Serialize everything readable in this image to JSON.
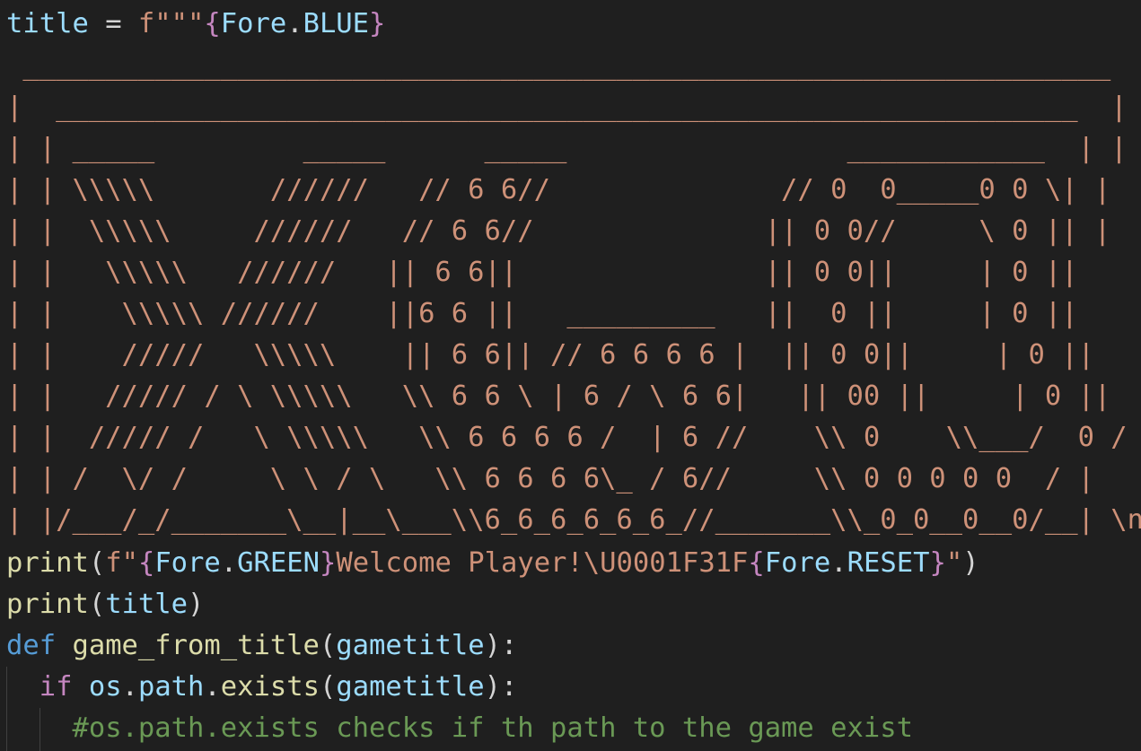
{
  "editor": {
    "colors": {
      "background": "#1f1f1f",
      "default_text": "#d4d4d4",
      "keyword": "#569cd6",
      "control": "#c586c0",
      "function": "#dcdcaa",
      "variable": "#9cdcfe",
      "string": "#ce9178",
      "comment": "#6a9955",
      "indent_guide": "#404040"
    },
    "line1": {
      "var": "title",
      "op": " = ",
      "prefix": "f\"\"\"",
      "brace_open": "{",
      "obj": "Fore",
      "dot": ".",
      "attr": "BLUE",
      "brace_close": "}"
    },
    "ascii_art": [
      " __________________________________________________________________",
      "|  ______________________________________________________________  |",
      "| | _____         _____      _____                 ____________  | |",
      "| | \\\\\\\\\\       //////   // 6 6//              // 0  0_____0 0 \\| |",
      "| |  \\\\\\\\\\     //////   // 6 6//              || 0 0//     \\ 0 || |",
      "| |   \\\\\\\\\\   //////   || 6 6||               || 0 0||     | 0 ||",
      "| |    \\\\\\\\\\ //////    ||6 6 ||   _________   ||  0 ||     | 0 ||",
      "| |    /////   \\\\\\\\\\    || 6 6|| // 6 6 6 6 |  || 0 0||     | 0 ||",
      "| |   ///// / \\ \\\\\\\\\\   \\\\ 6 6 \\ | 6 / \\ 6 6|   || 00 ||     | 0 ||",
      "| |  ///// /   \\ \\\\\\\\\\   \\\\ 6 6 6 6 /  | 6 //    \\\\ 0    \\\\___/  0 /",
      "| | /  \\/ /     \\ \\ / \\   \\\\ 6 6 6 6\\_ / 6//     \\\\ 0 0 0 0 0  / |",
      "| |/___/_/_______\\__|__\\___\\\\6_6_6_6_6_6_//_______\\\\_0_0__0__0/__| \\n"
    ],
    "line_print1": {
      "fn": "print",
      "paren_open": "(",
      "prefix": "f\"",
      "brace1_open": "{",
      "obj1": "Fore",
      "dot1": ".",
      "attr1": "GREEN",
      "brace1_close": "}",
      "text": "Welcome Player!\\U0001F31F",
      "brace2_open": "{",
      "obj2": "Fore",
      "dot2": ".",
      "attr2": "RESET",
      "brace2_close": "}",
      "quote_close": "\"",
      "paren_close": ")"
    },
    "line_print2": {
      "fn": "print",
      "paren_open": "(",
      "arg": "title",
      "paren_close": ")"
    },
    "line_def": {
      "keyword": "def",
      "space": " ",
      "name": "game_from_title",
      "paren_open": "(",
      "param": "gametitle",
      "paren_close": ")",
      "colon": ":"
    },
    "line_if": {
      "indent": "  ",
      "keyword": "if",
      "space": " ",
      "obj": "os",
      "dot1": ".",
      "attr": "path",
      "dot2": ".",
      "method": "exists",
      "paren_open": "(",
      "arg": "gametitle",
      "paren_close": ")",
      "colon": ":"
    },
    "line_comment": {
      "indent": "    ",
      "text": "#os.path.exists checks if th path to the game exist"
    }
  }
}
